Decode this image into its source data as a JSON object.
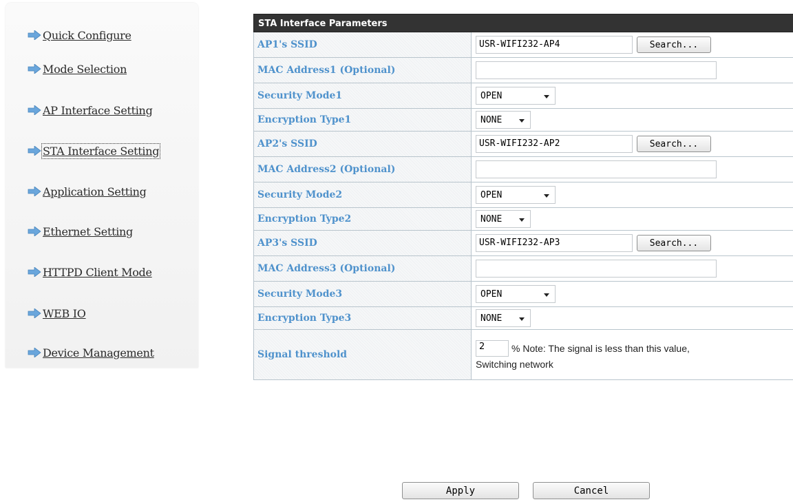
{
  "sidebar": {
    "items": [
      {
        "label": "Quick Configure",
        "icon": "arrow-right-icon"
      },
      {
        "label": "Mode Selection",
        "icon": "arrow-right-icon"
      },
      {
        "label": "AP Interface Setting",
        "icon": "arrow-right-icon"
      },
      {
        "label": "STA Interface Setting",
        "icon": "arrow-right-icon",
        "active": true
      },
      {
        "label": "Application Setting",
        "icon": "arrow-right-icon"
      },
      {
        "label": "Ethernet Setting",
        "icon": "arrow-right-icon"
      },
      {
        "label": "HTTPD Client Mode",
        "icon": "arrow-right-icon"
      },
      {
        "label": "WEB IO",
        "icon": "arrow-right-icon"
      },
      {
        "label": "Device Management",
        "icon": "arrow-right-icon"
      }
    ]
  },
  "table": {
    "header": "STA Interface Parameters",
    "ap1": {
      "ssid_label": "AP1's SSID",
      "ssid_value": "USR-WIFI232-AP4",
      "search_label": "Search...",
      "mac_label": "MAC Address1 (Optional)",
      "mac_value": "",
      "security_label": "Security Mode1",
      "security_value": "OPEN",
      "encryption_label": "Encryption Type1",
      "encryption_value": "NONE"
    },
    "ap2": {
      "ssid_label": "AP2's SSID",
      "ssid_value": "USR-WIFI232-AP2",
      "search_label": "Search...",
      "mac_label": "MAC Address2 (Optional)",
      "mac_value": "",
      "security_label": "Security Mode2",
      "security_value": "OPEN",
      "encryption_label": "Encryption Type2",
      "encryption_value": "NONE"
    },
    "ap3": {
      "ssid_label": "AP3's SSID",
      "ssid_value": "USR-WIFI232-AP3",
      "search_label": "Search...",
      "mac_label": "MAC Address3 (Optional)",
      "mac_value": "",
      "security_label": "Security Mode3",
      "security_value": "OPEN",
      "encryption_label": "Encryption Type3",
      "encryption_value": "NONE"
    },
    "threshold": {
      "label": "Signal threshold",
      "value": "2",
      "note_line1": "% Note: The signal is less than this value,",
      "note_line2": "Switching network"
    }
  },
  "actions": {
    "apply_label": "Apply",
    "cancel_label": "Cancel"
  },
  "colors": {
    "header_bg": "#333333",
    "label_text": "#4f92cc",
    "arrow_blue": "#6aa6dc"
  }
}
